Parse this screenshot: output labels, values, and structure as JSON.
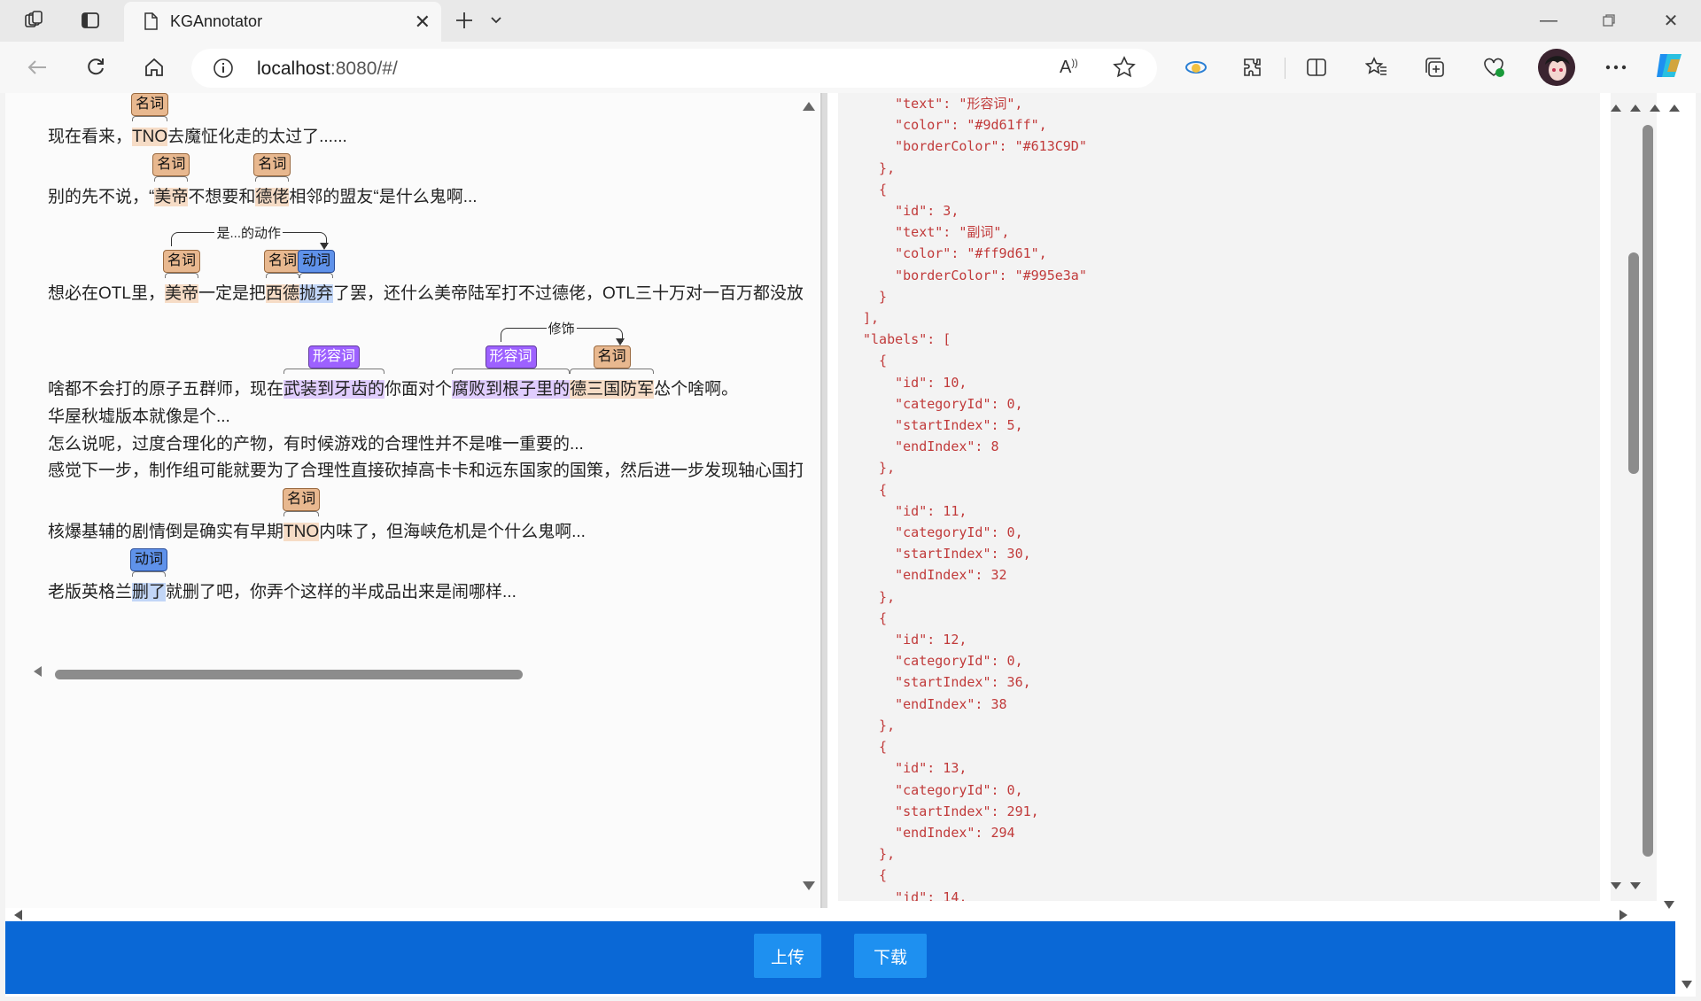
{
  "browser": {
    "tab_title": "KGAnnotator",
    "url_host": "localhost",
    "url_rest": ":8080/#/"
  },
  "annotator": {
    "lines": [
      {
        "segments": [
          {
            "t": "现在看来，"
          },
          {
            "t": "TNO",
            "hl": "noun"
          },
          {
            "t": "去魔怔化走的太过了......"
          }
        ],
        "labels": [
          {
            "text": "名词",
            "type": "noun"
          }
        ]
      },
      {
        "segments": [
          {
            "t": "别的先不说，“"
          },
          {
            "t": "美帝",
            "hl": "noun"
          },
          {
            "t": "不想要和"
          },
          {
            "t": "德佬",
            "hl": "noun"
          },
          {
            "t": "相邻的盟友“是什么鬼啊..."
          }
        ],
        "labels": [
          {
            "text": "名词",
            "type": "noun"
          },
          {
            "text": "名词",
            "type": "noun"
          }
        ]
      },
      {
        "segments": [
          {
            "t": "想必在OTL里，"
          },
          {
            "t": "美帝",
            "hl": "noun"
          },
          {
            "t": "一定是把"
          },
          {
            "t": "西德",
            "hl": "noun"
          },
          {
            "t": "抛弃",
            "hl": "verb"
          },
          {
            "t": "了罢，还什么美帝陆军打不过德佬，OTL三十万对一百万都没放"
          }
        ],
        "labels": [
          {
            "text": "名词",
            "type": "noun"
          },
          {
            "text": "名词",
            "type": "noun"
          },
          {
            "text": "动词",
            "type": "verb"
          }
        ],
        "relation": "是...的动作"
      },
      {
        "segments": [
          {
            "t": "啥都不会打的原子五群师，现在"
          },
          {
            "t": "武装到牙齿的",
            "hl": "adj"
          },
          {
            "t": "你面对个"
          },
          {
            "t": "腐败到根子里的",
            "hl": "adj"
          },
          {
            "t": "德三国防军",
            "hl": "noun"
          },
          {
            "t": "怂个啥啊。"
          }
        ],
        "labels": [
          {
            "text": "形容词",
            "type": "adj"
          },
          {
            "text": "形容词",
            "type": "adj"
          },
          {
            "text": "名词",
            "type": "noun"
          }
        ],
        "relation": "修饰"
      },
      {
        "segments": [
          {
            "t": "华屋秋墟版本就像是个..."
          }
        ]
      },
      {
        "segments": [
          {
            "t": "怎么说呢，过度合理化的产物，有时候游戏的合理性并不是唯一重要的..."
          }
        ]
      },
      {
        "segments": [
          {
            "t": "感觉下一步，制作组可能就要为了合理性直接砍掉高卡卡和远东国家的国策，然后进一步发现轴心国打"
          }
        ]
      },
      {
        "segments": [
          {
            "t": "核爆基辅的剧情倒是确实有早期"
          },
          {
            "t": "TNO",
            "hl": "noun"
          },
          {
            "t": "内味了，但海峡危机是个什么鬼啊..."
          }
        ],
        "labels": [
          {
            "text": "名词",
            "type": "noun"
          }
        ]
      },
      {
        "segments": [
          {
            "t": "老版英格兰"
          },
          {
            "t": "删了",
            "hl": "verb"
          },
          {
            "t": "就删了吧，你弄个这样的半成品出来是闹哪样..."
          }
        ],
        "labels": [
          {
            "text": "动词",
            "type": "verb"
          }
        ]
      }
    ]
  },
  "json_view": {
    "lines": [
      "    \"text\": \"形容词\",",
      "    \"color\": \"#9d61ff\",",
      "    \"borderColor\": \"#613C9D\"",
      "  },",
      "  {",
      "    \"id\": 3,",
      "    \"text\": \"副词\",",
      "    \"color\": \"#ff9d61\",",
      "    \"borderColor\": \"#995e3a\"",
      "  }",
      "],",
      "\"labels\": [",
      "  {",
      "    \"id\": 10,",
      "    \"categoryId\": 0,",
      "    \"startIndex\": 5,",
      "    \"endIndex\": 8",
      "  },",
      "  {",
      "    \"id\": 11,",
      "    \"categoryId\": 0,",
      "    \"startIndex\": 30,",
      "    \"endIndex\": 32",
      "  },",
      "  {",
      "    \"id\": 12,",
      "    \"categoryId\": 0,",
      "    \"startIndex\": 36,",
      "    \"endIndex\": 38",
      "  },",
      "  {",
      "    \"id\": 13,",
      "    \"categoryId\": 0,",
      "    \"startIndex\": 291,",
      "    \"endIndex\": 294",
      "  },",
      "  {",
      "    \"id\": 14,"
    ]
  },
  "footer": {
    "upload_label": "上传",
    "download_label": "下载"
  },
  "colors": {
    "noun": "#e8b88f",
    "verb": "#5f92ea",
    "adj": "#9d61ff",
    "footer": "#0a68d6",
    "json_text": "#c13a3a"
  },
  "icons": [
    "workspaces-icon",
    "tab-actions-icon",
    "page-icon",
    "close-icon",
    "new-tab-icon",
    "chevron-down-icon",
    "back-icon",
    "refresh-icon",
    "home-icon",
    "info-icon",
    "read-aloud-icon",
    "favorite-star-icon",
    "extension-icon",
    "split-screen-icon",
    "favorites-icon",
    "collections-icon",
    "performance-icon",
    "avatar",
    "more-icon",
    "copilot-icon"
  ]
}
